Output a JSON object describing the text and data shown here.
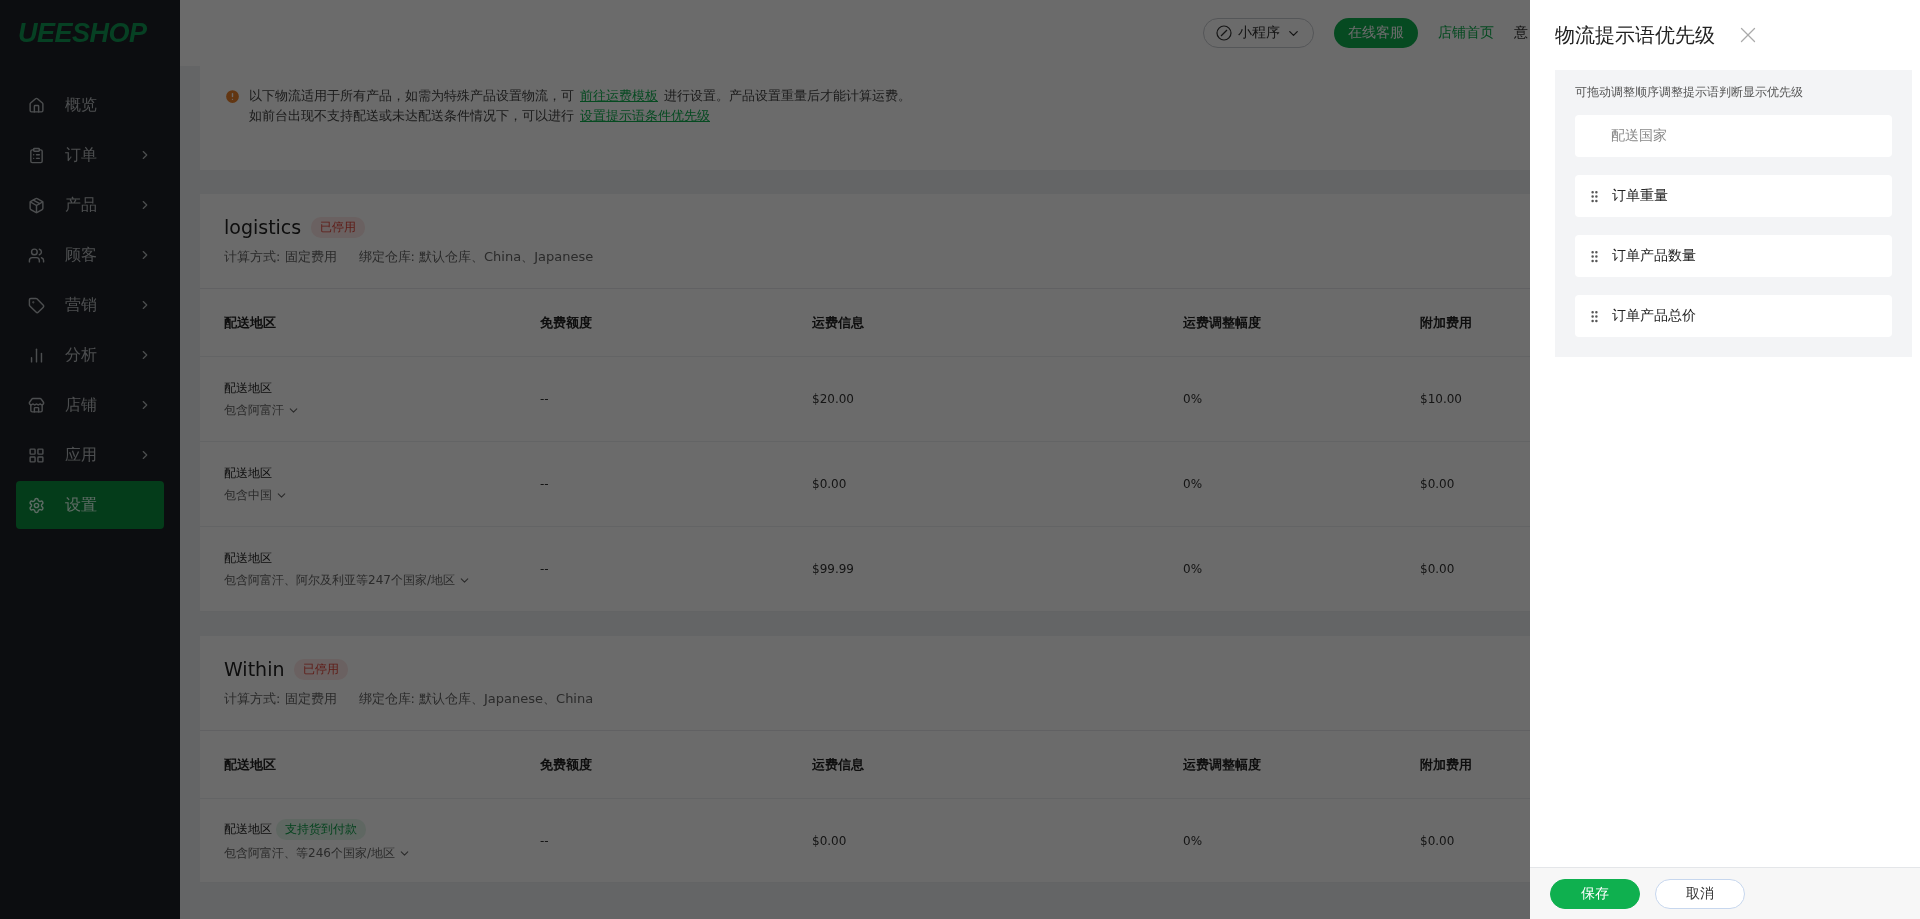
{
  "logo": "UEESHOP",
  "sidebar": {
    "items": [
      {
        "label": "概览",
        "has_submenu": false,
        "selected": false
      },
      {
        "label": "订单",
        "has_submenu": true,
        "selected": false
      },
      {
        "label": "产品",
        "has_submenu": true,
        "selected": false
      },
      {
        "label": "顾客",
        "has_submenu": true,
        "selected": false
      },
      {
        "label": "营销",
        "has_submenu": true,
        "selected": false
      },
      {
        "label": "分析",
        "has_submenu": true,
        "selected": false
      },
      {
        "label": "店铺",
        "has_submenu": true,
        "selected": false
      },
      {
        "label": "应用",
        "has_submenu": true,
        "selected": false
      },
      {
        "label": "设置",
        "has_submenu": false,
        "selected": true
      }
    ]
  },
  "header": {
    "mini_program": "小程序",
    "support_button": "在线客服",
    "store_link": "店铺首页",
    "cut_link": "意"
  },
  "notice": {
    "lines": [
      {
        "before": "以下物流适用于所有产品，如需为特殊产品设置物流，可",
        "link": "前往运费模板",
        "after": "进行设置。产品设置重量后才能计算运费。"
      },
      {
        "before": "如前台出现不支持配送或未达配送条件情况下，可以进行",
        "link": "设置提示语条件优先级"
      }
    ]
  },
  "logistics": [
    {
      "name": "logistics",
      "status": "已停用",
      "method": "计算方式: 固定费用",
      "warehouse": "绑定仓库: 默认仓库、China、Japanese",
      "columns": [
        "配送地区",
        "免费额度",
        "运费信息",
        "运费调整幅度",
        "附加费用"
      ],
      "rows": [
        {
          "label": "配送地区",
          "region": "包含阿富汗",
          "free": "--",
          "fee": "$20.00",
          "adjust": "0%",
          "extra": "$10.00"
        },
        {
          "label": "配送地区",
          "region": "包含中国",
          "free": "--",
          "fee": "$0.00",
          "adjust": "0%",
          "extra": "$0.00"
        },
        {
          "label": "配送地区",
          "region": "包含阿富汗、阿尔及利亚等247个国家/地区",
          "free": "--",
          "fee": "$99.99",
          "adjust": "0%",
          "extra": "$0.00"
        }
      ]
    },
    {
      "name": "Within",
      "status": "已停用",
      "method": "计算方式: 固定费用",
      "warehouse": "绑定仓库: 默认仓库、Japanese、China",
      "columns": [
        "配送地区",
        "免费额度",
        "运费信息",
        "运费调整幅度",
        "附加费用"
      ],
      "rows": [
        {
          "label": "配送地区",
          "tag": "支持货到付款",
          "region": "包含阿富汗、等246个国家/地区",
          "free": "--",
          "fee": "$0.00",
          "adjust": "0%",
          "extra": "$0.00"
        }
      ]
    }
  ],
  "drawer": {
    "title": "物流提示语优先级",
    "hint": "可拖动调整顺序调整提示语判断显示优先级",
    "items": [
      {
        "label": "配送国家",
        "kind": "fixed"
      },
      {
        "label": "订单重量",
        "kind": "draggable"
      },
      {
        "label": "订单产品数量",
        "kind": "draggable"
      },
      {
        "label": "订单产品总价",
        "kind": "draggable"
      }
    ],
    "buttons": [
      {
        "label": "保存",
        "kind": "primary"
      },
      {
        "label": "取消",
        "kind": "secondary"
      }
    ]
  }
}
